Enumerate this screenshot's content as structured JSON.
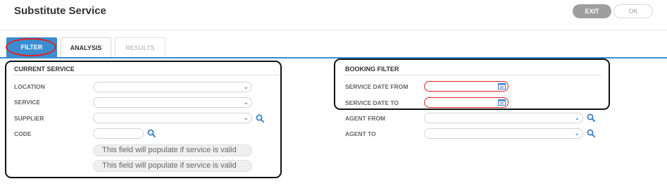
{
  "header": {
    "title": "Substitute Service",
    "exit_label": "EXIT",
    "ok_label": "OK"
  },
  "tabs": [
    {
      "label": "FILTER",
      "state": "active"
    },
    {
      "label": "ANALYSIS",
      "state": "enabled"
    },
    {
      "label": "RESULTS",
      "state": "disabled"
    }
  ],
  "current_service": {
    "title": "CURRENT SERVICE",
    "location_label": "LOCATION",
    "service_label": "SERVICE",
    "supplier_label": "SUPPLIER",
    "code_label": "CODE",
    "note1": "This field will  populate if service is valid",
    "note2": "This field will  populate if service is valid"
  },
  "booking_filter": {
    "title": "BOOKING FILTER",
    "date_from_label": "SERVICE DATE FROM",
    "date_to_label": "SERVICE DATE TO",
    "agent_from_label": "AGENT FROM",
    "agent_to_label": "AGENT TO"
  },
  "icons": {
    "chevron": "chevron-down-icon",
    "search": "search-icon",
    "calendar": "calendar-icon"
  },
  "colors": {
    "accent": "#3c8dcf",
    "highlight": "#e02020",
    "icon_blue": "#3c7fc4"
  }
}
